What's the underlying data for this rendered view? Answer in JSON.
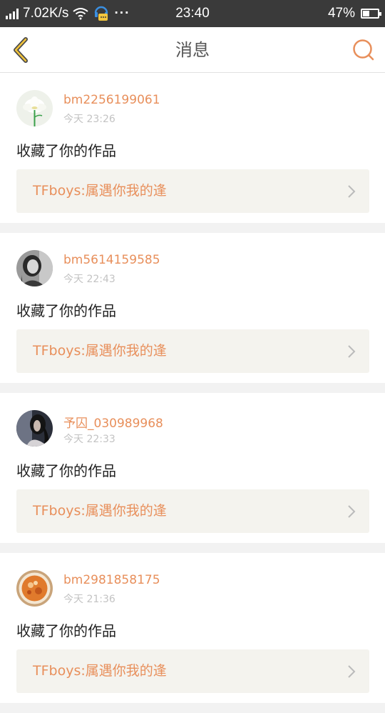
{
  "status_bar": {
    "speed": "7.02K/s",
    "more": "···",
    "time": "23:40",
    "battery": "47%",
    "battery_level": 0.47
  },
  "navbar": {
    "title": "消息",
    "back_icon": "chevron-left-icon",
    "search_icon": "search-icon"
  },
  "colors": {
    "accent": "#e88f5b",
    "card_bg": "#f4f3ee"
  },
  "messages": [
    {
      "username": "bm2256199061",
      "time": "今天 23:26",
      "action": "收藏了你的作品",
      "work_title": "TFboys:属遇你我的逢",
      "avatar": "lotus-flower"
    },
    {
      "username": "bm5614159585",
      "time": "今天 22:43",
      "action": "收藏了你的作品",
      "work_title": "TFboys:属遇你我的逢",
      "avatar": "bw-portrait"
    },
    {
      "username": "予囚_030989968",
      "time": "今天 22:33",
      "action": "收藏了你的作品",
      "work_title": "TFboys:属遇你我的逢",
      "avatar": "dark-portrait"
    },
    {
      "username": "bm2981858175",
      "time": "今天 21:36",
      "action": "收藏了你的作品",
      "work_title": "TFboys:属遇你我的逢",
      "avatar": "orange-food"
    }
  ]
}
